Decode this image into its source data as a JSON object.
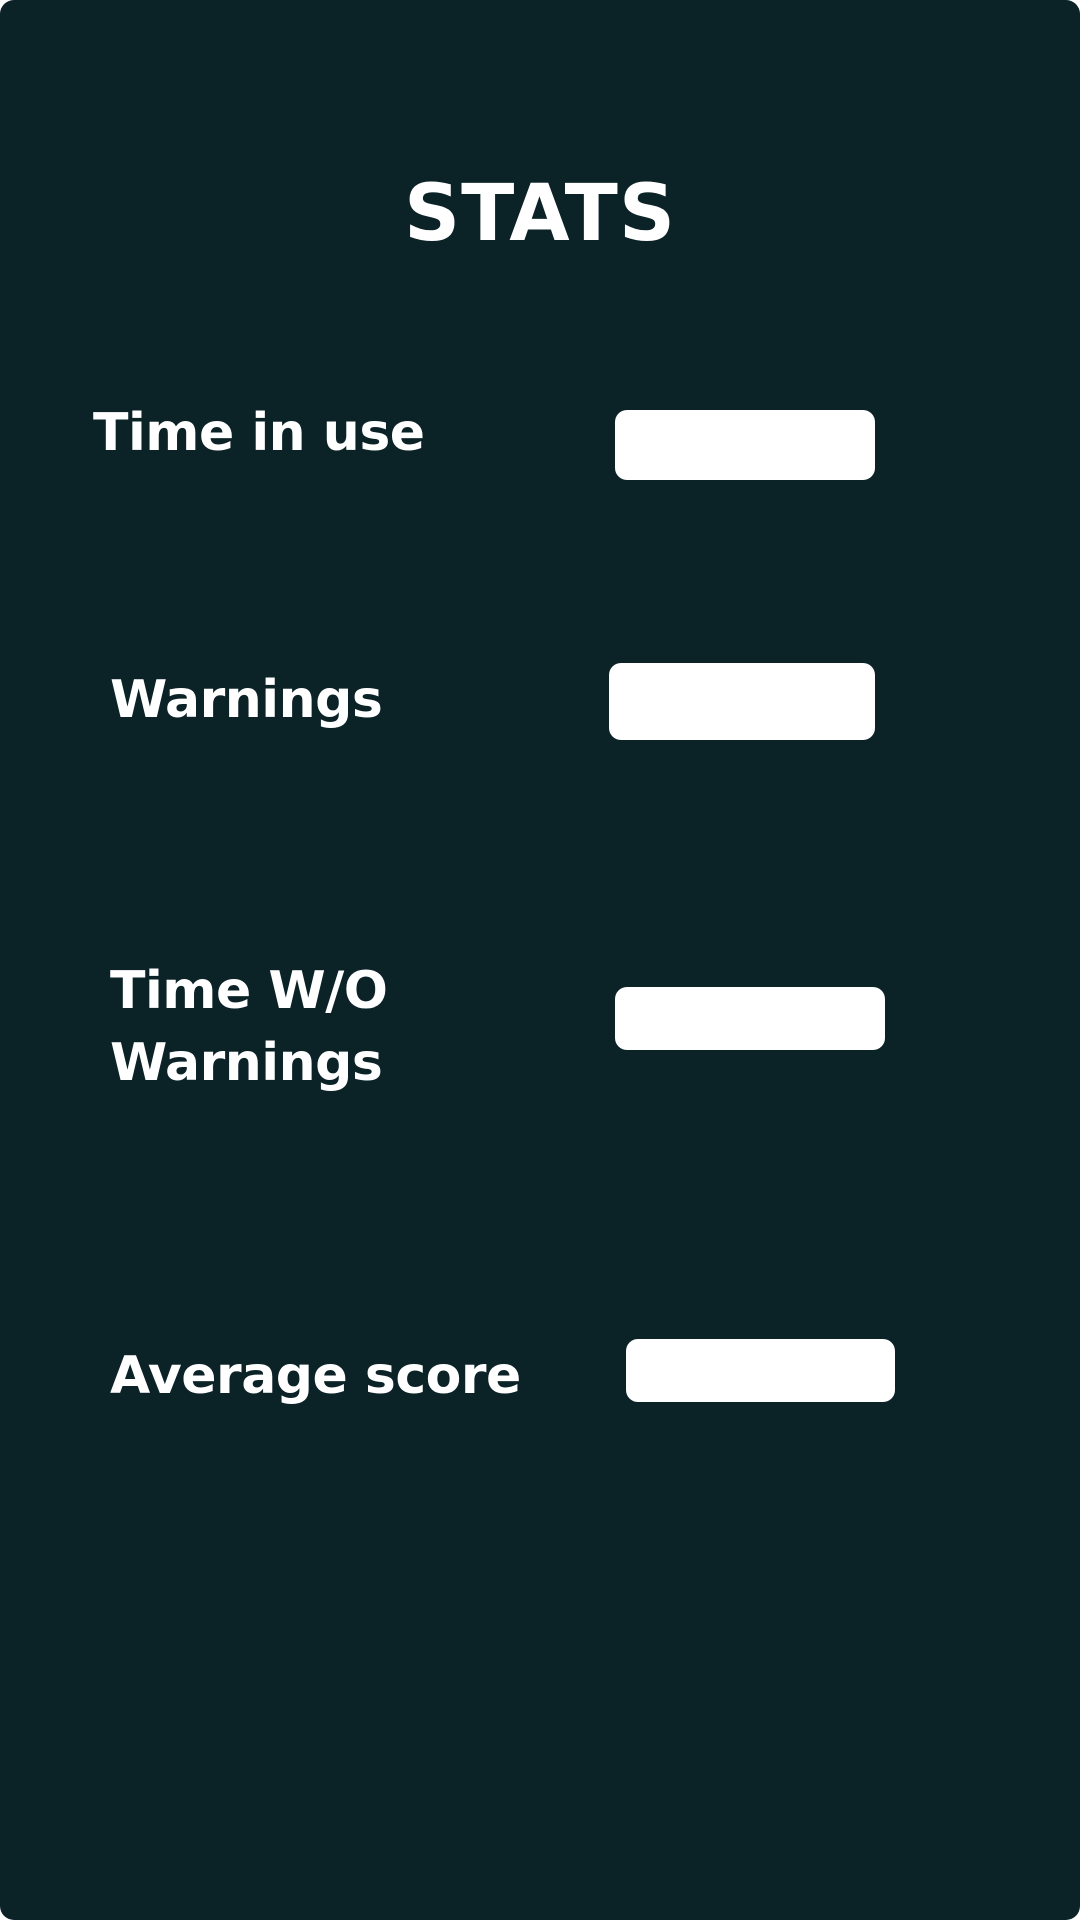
{
  "screen": {
    "title": "STATS",
    "background_color": "#0b2227",
    "text_color": "#ffffff",
    "value_box_color": "#ffffff"
  },
  "stats": [
    {
      "label": "Time in use",
      "value": ""
    },
    {
      "label": "Warnings",
      "value": ""
    },
    {
      "label_line1": "Time W/O",
      "label_line2": "Warnings",
      "value": ""
    },
    {
      "label": "Average score",
      "value": ""
    }
  ]
}
